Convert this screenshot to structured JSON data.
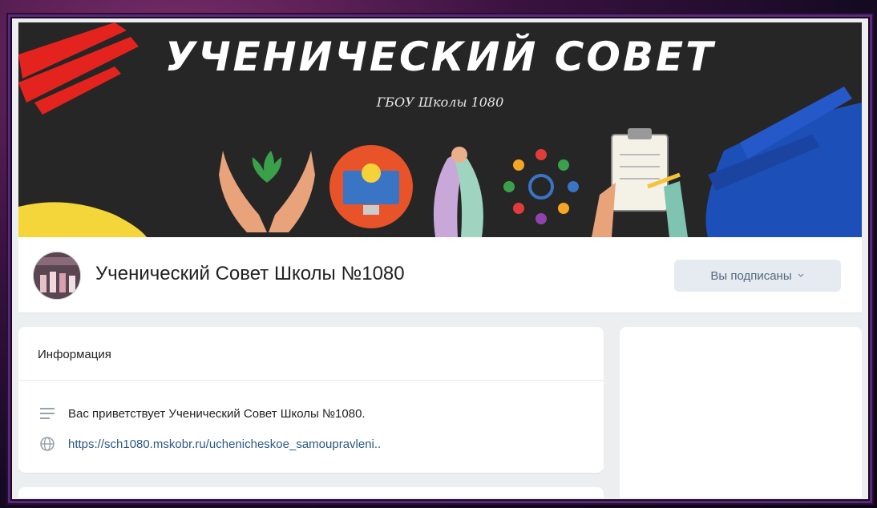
{
  "cover": {
    "title": "УЧЕНИЧЕСКИЙ СОВЕТ",
    "subtitle": "ГБОУ Школы 1080",
    "illustrations": [
      "hands-plant-icon",
      "computer-lightbulb-icon",
      "raised-hands-icon",
      "people-circle-icon",
      "clipboard-writing-icon"
    ]
  },
  "header": {
    "group_name": "Ученический Совет Школы №1080",
    "subscribe_label": "Вы подписаны"
  },
  "info": {
    "title": "Информация",
    "description": "Вас приветствует Ученический Совет Школы №1080.",
    "link": "https://sch1080.mskobr.ru/uchenicheskoe_samoupravleni.."
  },
  "colors": {
    "cover_bg": "#262626",
    "link": "#2a5885",
    "button_bg": "#e5ebf1",
    "button_text": "#55677d",
    "page_bg": "#edeef0",
    "frame": "#5a2a7a"
  }
}
